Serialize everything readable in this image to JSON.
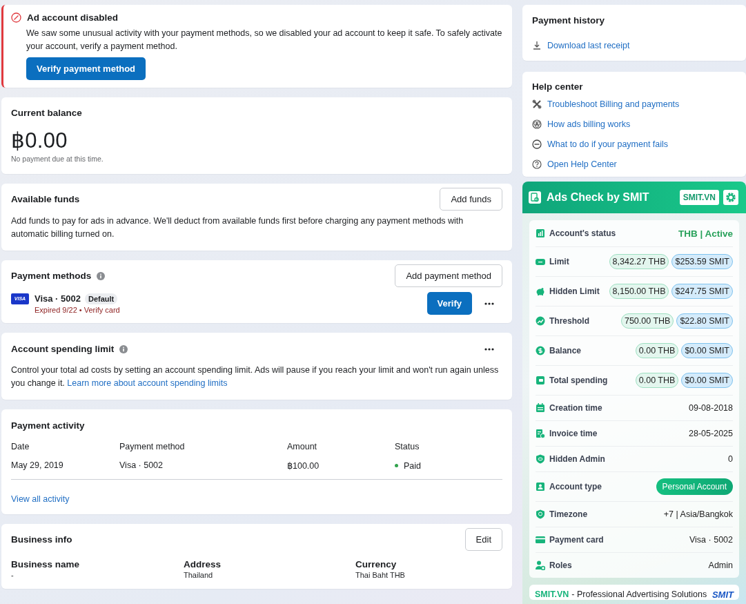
{
  "alert": {
    "title": "Ad account disabled",
    "message": "We saw some unusual activity with your payment methods, so we disabled your ad account to keep it safe. To safely activate your account, verify a payment method.",
    "button": "Verify payment method"
  },
  "current_balance": {
    "title": "Current balance",
    "amount": "฿0.00",
    "note": "No payment due at this time."
  },
  "available_funds": {
    "title": "Available funds",
    "button": "Add funds",
    "description": "Add funds to pay for ads in advance. We'll deduct from available funds first before charging any payment methods with automatic billing turned on."
  },
  "payment_methods": {
    "title": "Payment methods",
    "button": "Add payment method",
    "cards": [
      {
        "brand": "VISA",
        "name": "Visa · 5002",
        "badge": "Default",
        "status": "Expired 9/22 • Verify card",
        "button": "Verify"
      }
    ]
  },
  "spending_limit": {
    "title": "Account spending limit",
    "description": "Control your total ad costs by setting an account spending limit. Ads will pause if you reach your limit and won't run again unless you change it.",
    "link": "Learn more about account spending limits"
  },
  "payment_activity": {
    "title": "Payment activity",
    "columns": [
      "Date",
      "Payment method",
      "Amount",
      "Status"
    ],
    "rows": [
      {
        "date": "May 29, 2019",
        "method": "Visa · 5002",
        "amount": "฿100.00",
        "status": "Paid"
      }
    ],
    "link": "View all activity"
  },
  "business_info": {
    "title": "Business info",
    "button": "Edit",
    "fields": [
      {
        "label": "Business name",
        "value": "-"
      },
      {
        "label": "Address",
        "value": "Thailand"
      },
      {
        "label": "Currency",
        "value": "Thai Baht THB"
      }
    ]
  },
  "payment_history": {
    "title": "Payment history",
    "links": [
      "Download last receipt"
    ]
  },
  "help_center": {
    "title": "Help center",
    "links": [
      "Troubleshoot Billing and payments",
      "How ads billing works",
      "What to do if your payment fails",
      "Open Help Center"
    ]
  },
  "smit": {
    "title": "Ads Check by SMIT",
    "badge": "SMIT.VN",
    "rows": [
      {
        "kind": "status",
        "label": "Account's status",
        "value": "THB | Active"
      },
      {
        "kind": "pills",
        "label": "Limit",
        "thb": "8,342.27 THB",
        "smit": "$253.59 SMIT"
      },
      {
        "kind": "pills",
        "label": "Hidden Limit",
        "thb": "8,150.00 THB",
        "smit": "$247.75 SMIT"
      },
      {
        "kind": "pills",
        "label": "Threshold",
        "thb": "750.00 THB",
        "smit": "$22.80 SMIT"
      },
      {
        "kind": "pills",
        "label": "Balance",
        "thb": "0.00 THB",
        "smit": "$0.00 SMIT"
      },
      {
        "kind": "pills",
        "label": "Total spending",
        "thb": "0.00 THB",
        "smit": "$0.00 SMIT"
      },
      {
        "kind": "text",
        "label": "Creation time",
        "value": "09-08-2018"
      },
      {
        "kind": "text",
        "label": "Invoice time",
        "value": "28-05-2025"
      },
      {
        "kind": "text",
        "label": "Hidden Admin",
        "value": "0"
      },
      {
        "kind": "tag",
        "label": "Account type",
        "value": "Personal Account"
      },
      {
        "kind": "text",
        "label": "Timezone",
        "value": "+7 | Asia/Bangkok"
      },
      {
        "kind": "text",
        "label": "Payment card",
        "value": "Visa · 5002"
      },
      {
        "kind": "text",
        "label": "Roles",
        "value": "Admin"
      }
    ],
    "footer": {
      "link": "SMIT.VN",
      "tagline": "- Professional Advertising Solutions",
      "logo": "SMIT"
    }
  }
}
